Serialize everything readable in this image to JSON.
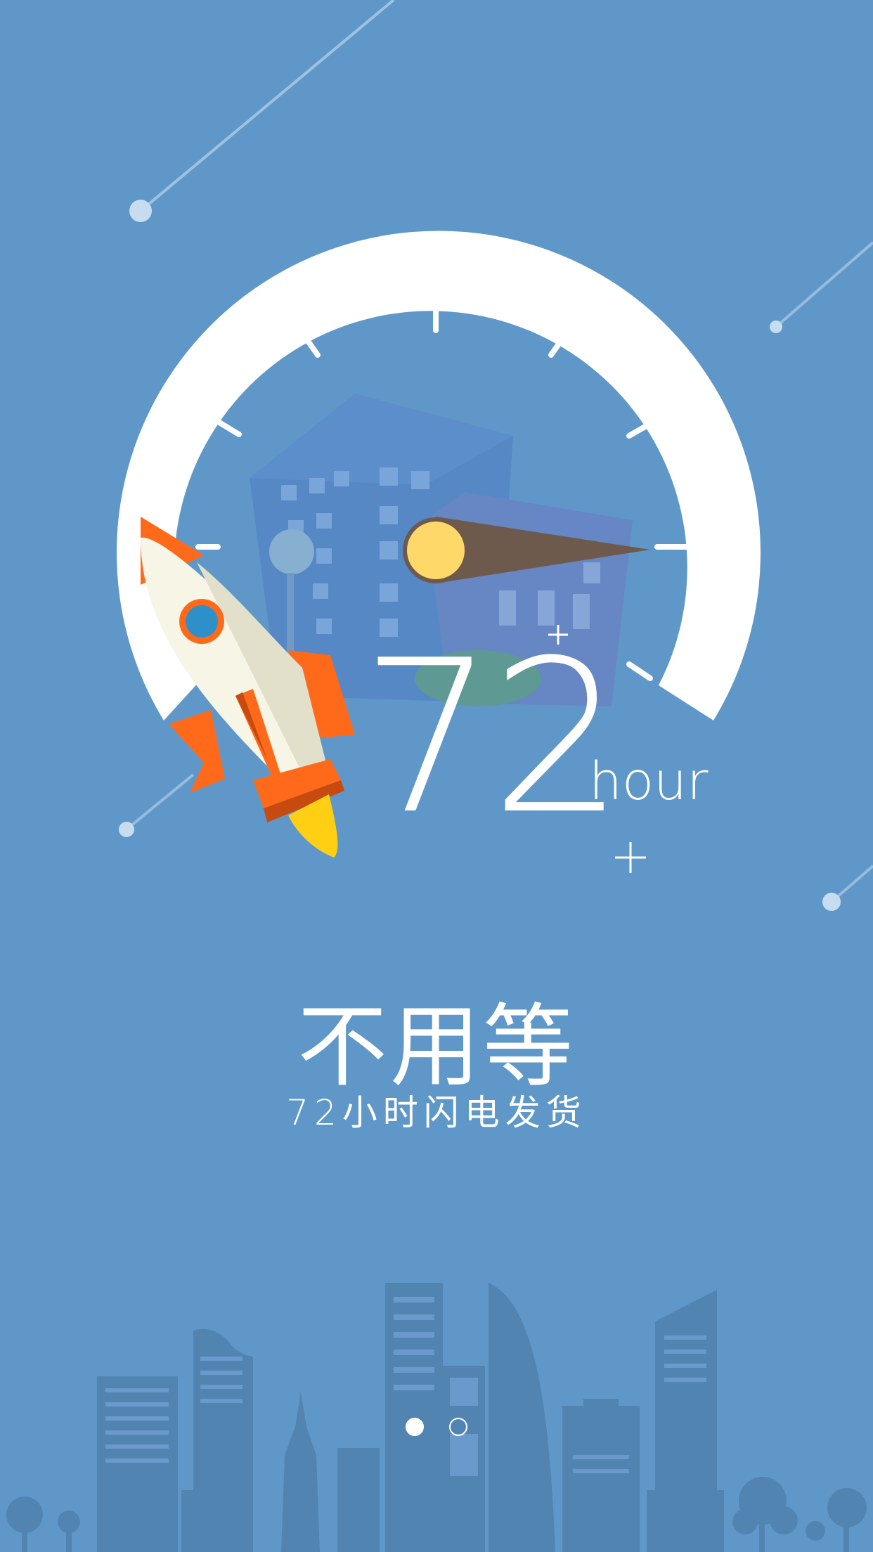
{
  "colors": {
    "background": "#5f98c8",
    "gauge": "#ffffff",
    "needle": "#6e5a4c",
    "needle_hub": "#ffd86a",
    "rocket_body": "#f4f1e2",
    "rocket_accent": "#ff6a1a",
    "rocket_window": "#2f8fc8",
    "flame": "#ffcf14",
    "city_silhouette": "#5284b2"
  },
  "gauge": {
    "value": "72",
    "unit": "hour"
  },
  "headline": "不用等",
  "subline": "72小时闪电发货",
  "icons": [
    "rocket-icon",
    "speedometer-gauge",
    "city-skyline",
    "meteor-streak",
    "sparkle-icon"
  ],
  "pager": {
    "pages": 2,
    "active_index": 0
  }
}
